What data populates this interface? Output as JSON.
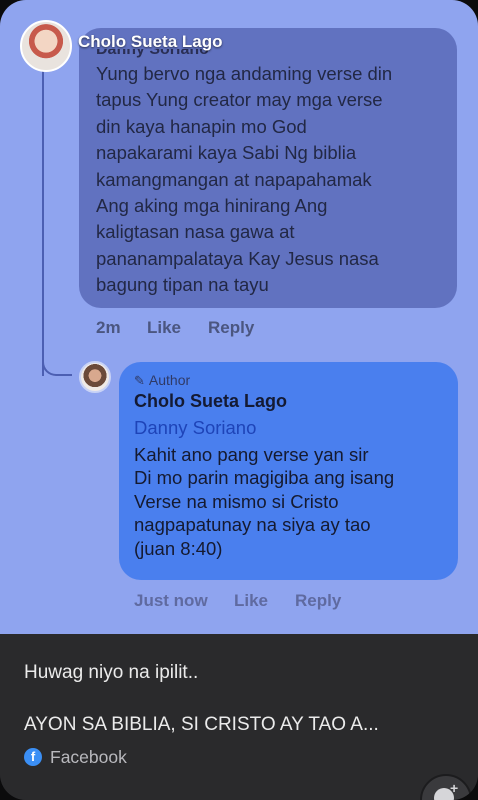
{
  "post": {
    "poster_name": "Cholo Sueta Lago"
  },
  "comment1": {
    "author_partial": "Danny Soriano",
    "body": "Yung bervo nga andaming verse din\ntapus Yung creator may mga verse\ndin kaya hanapin mo God\nnapakarami kaya Sabi Ng biblia\nkamangmangan at napapahamak\nAng aking mga hinirang Ang\nkaligtasan nasa gawa at\npananampalataya Kay Jesus nasa\nbagung tipan na tayu",
    "time": "2m",
    "like_label": "Like",
    "reply_label": "Reply"
  },
  "comment2": {
    "badge": "Author",
    "author": "Cholo Sueta Lago",
    "mention": "Danny Soriano",
    "body": "Kahit ano pang verse yan sir\nDi mo parin magigiba ang isang\nVerse na mismo si Cristo\nnagpapatunay na siya ay tao\n (juan 8:40)",
    "time": "Just now",
    "like_label": "Like",
    "reply_label": "Reply"
  },
  "preview": {
    "line1": "Huwag niyo na ipilit..",
    "line2": "AYON SA BIBLIA, SI CRISTO AY TAO A...",
    "source": "Facebook"
  },
  "colors": {
    "background": "#8fa4ef",
    "bubble1": "#6172c0",
    "bubble2": "#4a7fee",
    "preview_bg": "#2a2a2c",
    "mention": "#1e44b8"
  }
}
